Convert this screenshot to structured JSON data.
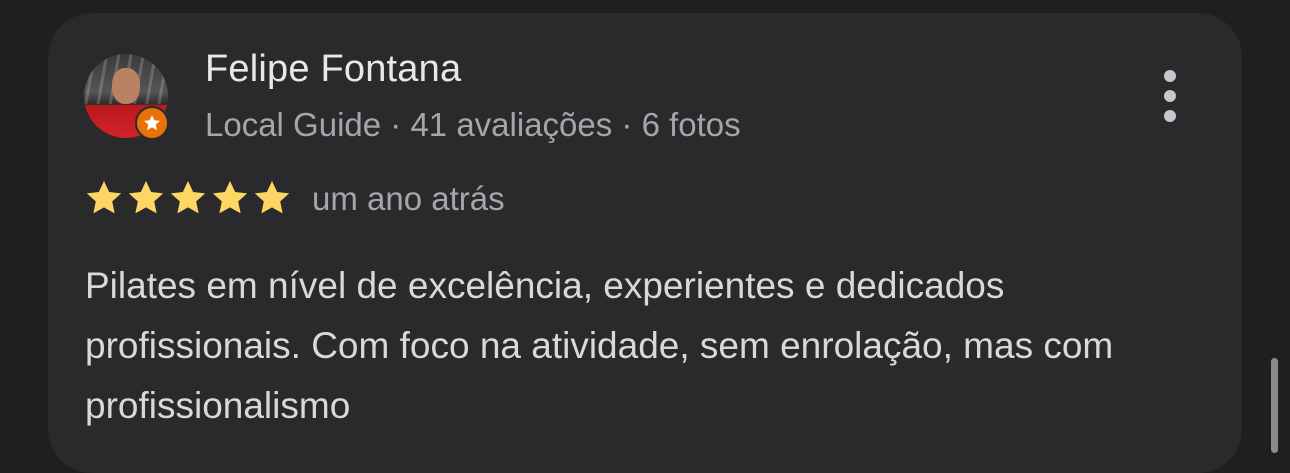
{
  "review": {
    "author_name": "Felipe Fontana",
    "author_meta": "Local Guide · 41 avaliações · 6 fotos",
    "rating": 5,
    "rating_max": 5,
    "time_ago": "um ano atrás",
    "text": "Pilates em nível de excelência, experientes e dedicados profissionais. Com foco na atividade, sem enrolação, mas com profissionalismo"
  },
  "icons": {
    "more": "more-vert-icon",
    "badge": "local-guide-star-icon",
    "star": "star-icon"
  },
  "colors": {
    "background": "#1f1f20",
    "card": "#2a2a2c",
    "star": "#fdd663",
    "badge": "#e8710a"
  }
}
